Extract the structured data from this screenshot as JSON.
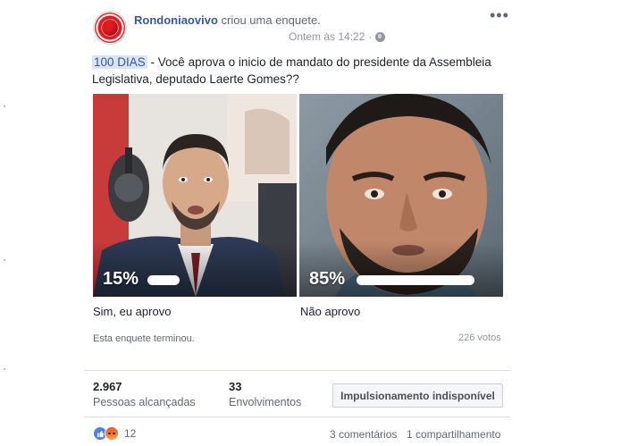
{
  "post": {
    "page_name": "Rondoniaovivo",
    "action_text": "criou uma enquete.",
    "timestamp": "Ontem às 14:22",
    "privacy_icon": "globe-icon",
    "more_icon": "more-options-icon",
    "more_glyph": "•••"
  },
  "poll": {
    "question_tag": "100 DIAS",
    "question_text": " - Você aprova o inicio de mandato do presidente da Assembleia Legislativa, deputado Laerte Gomes??",
    "options": [
      {
        "label": "Sim, eu aprovo",
        "percent_text": "15%",
        "percent": 15
      },
      {
        "label": "Não aprovo",
        "percent_text": "85%",
        "percent": 85
      }
    ],
    "status": "Esta enquete terminou.",
    "votes": "226 votos"
  },
  "insights": {
    "reach_value": "2.967",
    "reach_label": "Pessoas alcançadas",
    "engagement_value": "33",
    "engagement_label": "Envolvimentos",
    "boost_label": "Impulsionamento indisponível"
  },
  "footer": {
    "reaction_icons": [
      "like-icon",
      "angry-icon"
    ],
    "reaction_count": "12",
    "comments": "3 comentários",
    "shares": "1 compartilhamento"
  },
  "colors": {
    "link": "#365899",
    "tag_bg": "#dbe4f3",
    "brand_red": "#e01b22"
  }
}
